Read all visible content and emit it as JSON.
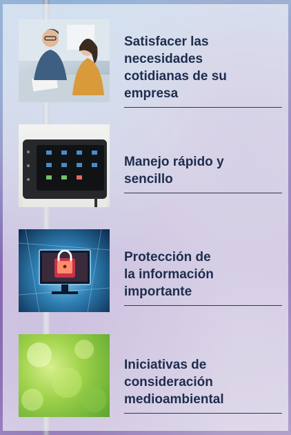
{
  "items": [
    {
      "title_lines": [
        "Satisfacer las",
        "necesidades",
        "cotidianas de su",
        "empresa"
      ],
      "image": "business-meeting-photo"
    },
    {
      "title_lines": [
        "Manejo rápido y",
        "sencillo"
      ],
      "image": "printer-touch-panel-photo"
    },
    {
      "title_lines": [
        "Protección de",
        "la información",
        "importante"
      ],
      "image": "security-lock-monitor-photo"
    },
    {
      "title_lines": [
        "Iniciativas de",
        "consideración",
        "medioambiental"
      ],
      "image": "green-bokeh-photo"
    }
  ],
  "colors": {
    "title": "#1d2d4e",
    "panel": "rgba(255,255,255,0.60)",
    "rule": "#2c3650"
  }
}
